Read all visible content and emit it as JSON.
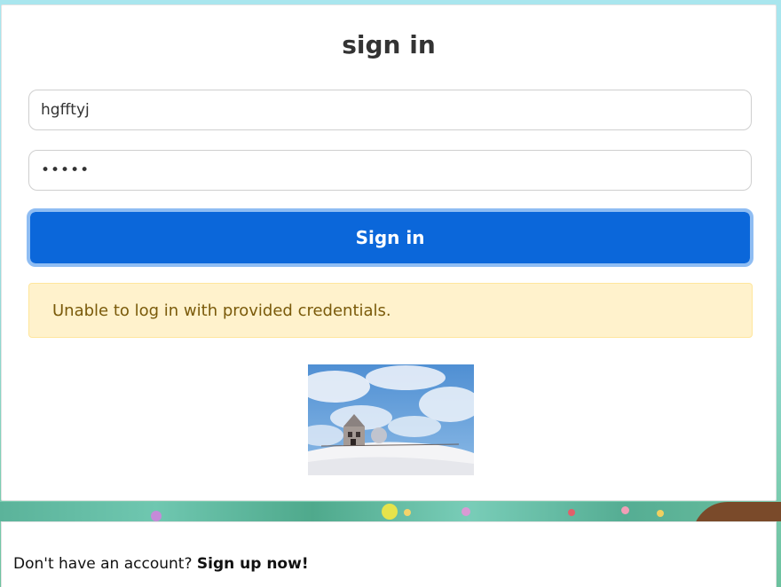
{
  "signin": {
    "title": "sign in",
    "username_value": "hgfftyj",
    "password_value": "•••••",
    "button_label": "Sign in",
    "error_message": "Unable to log in with provided credentials."
  },
  "footer": {
    "prompt": "Don't have an account?",
    "signup_link": "Sign up now!"
  },
  "colors": {
    "primary": "#0b67da",
    "alert_bg": "#fff2cc",
    "alert_text": "#7a5a0a"
  },
  "icons": {
    "image": "winter-house-photo"
  }
}
